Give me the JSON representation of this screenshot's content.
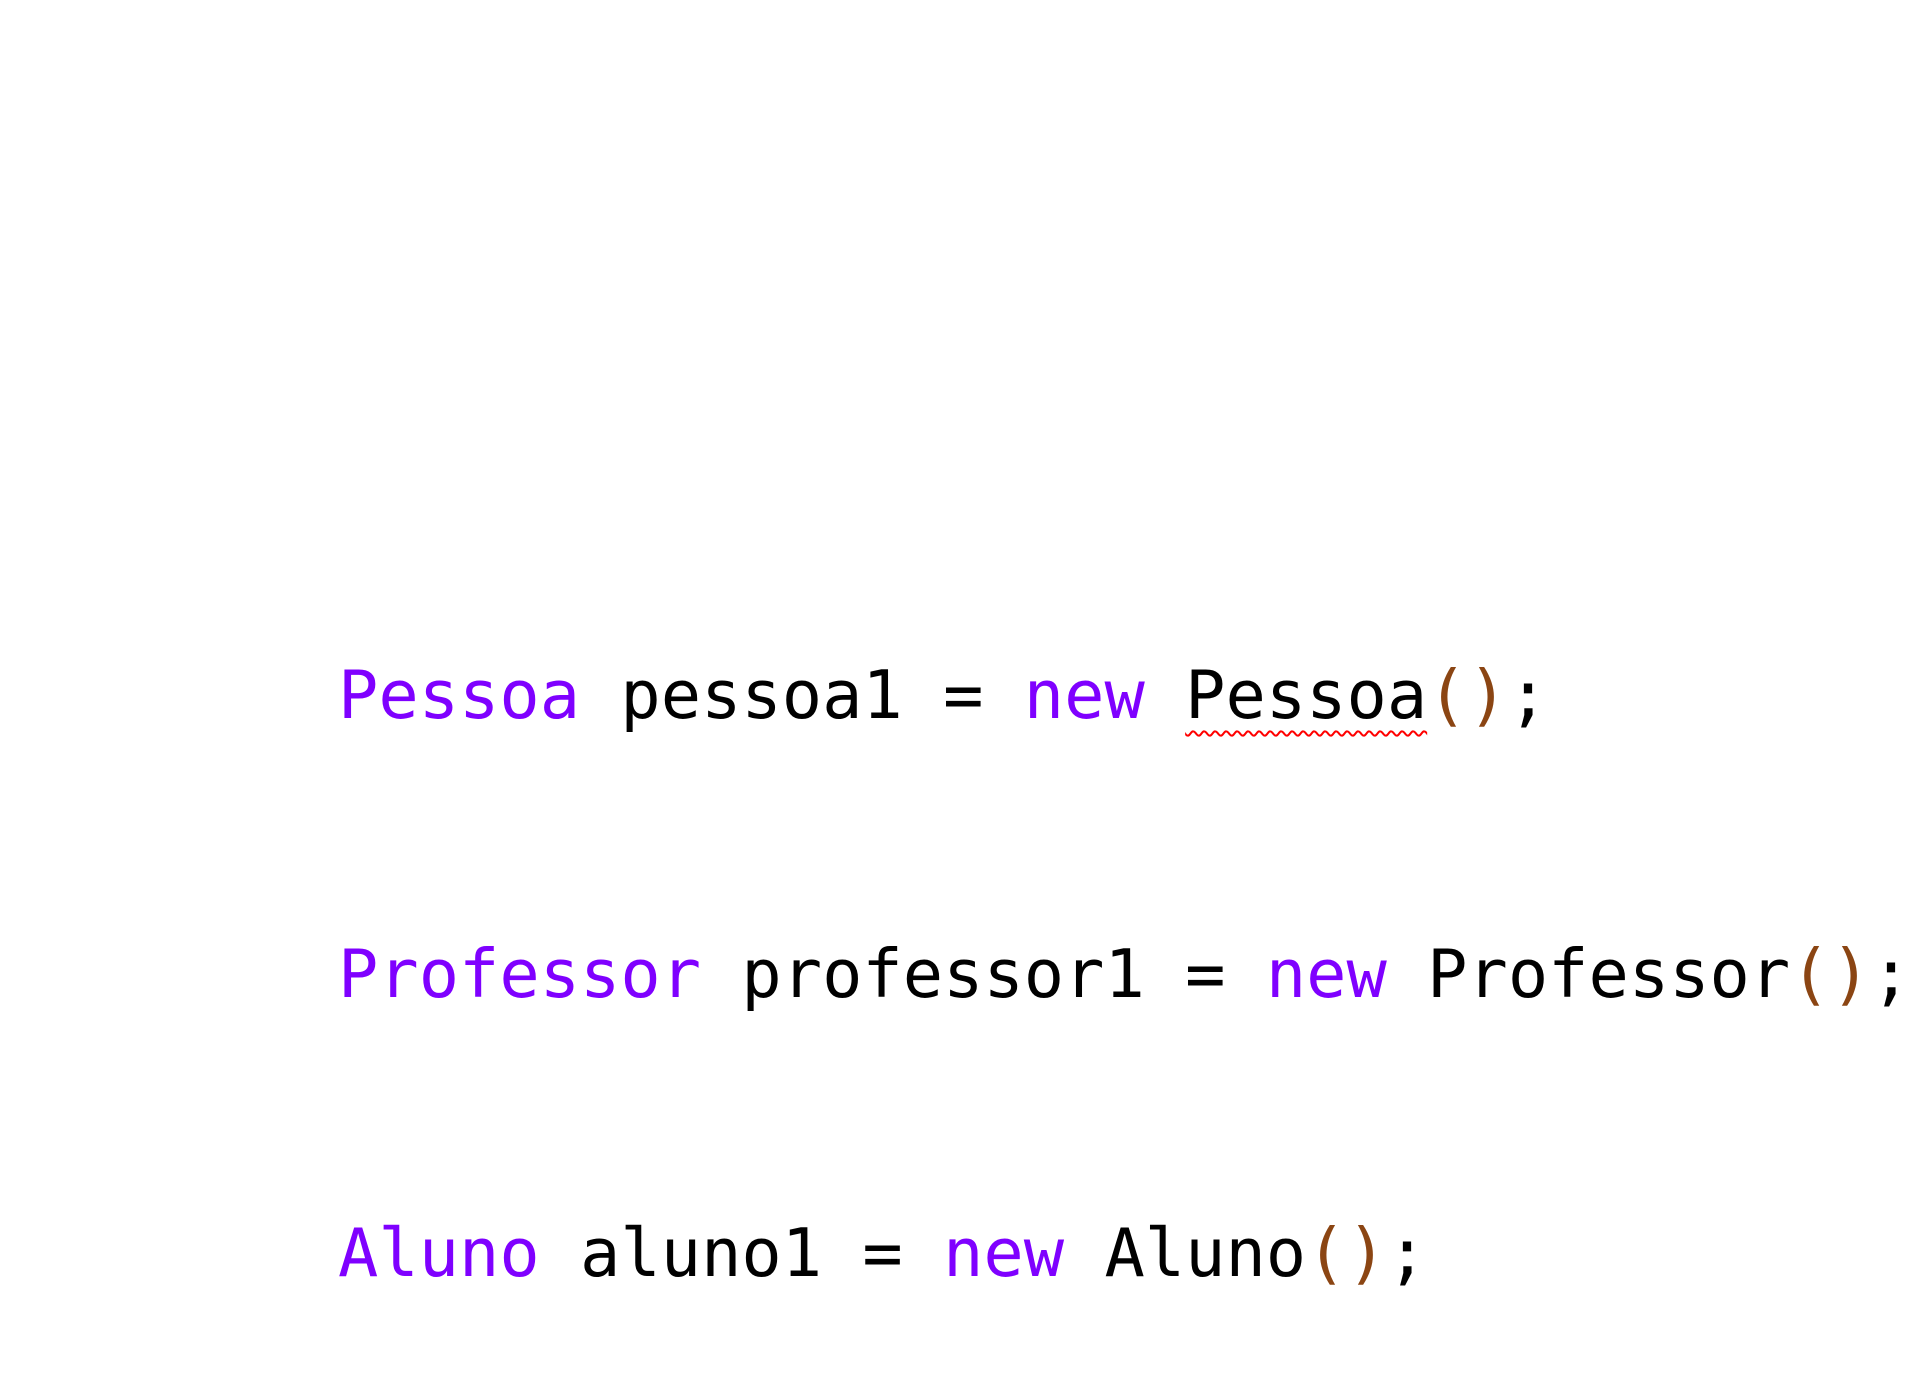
{
  "colors": {
    "type": "#7f00ff",
    "keyword": "#7f00ff",
    "identifier": "#000000",
    "paren": "#8b4513",
    "error_underline": "#ff0000"
  },
  "code": {
    "lines": [
      {
        "tokens": [
          {
            "text": "Pessoa",
            "kind": "type"
          },
          {
            "text": " pessoa1 = ",
            "kind": "identifier"
          },
          {
            "text": "new",
            "kind": "keyword"
          },
          {
            "text": " ",
            "kind": "identifier"
          },
          {
            "text": "Pessoa",
            "kind": "identifier",
            "error": true
          },
          {
            "text": "()",
            "kind": "paren"
          },
          {
            "text": ";",
            "kind": "identifier"
          }
        ]
      },
      {
        "tokens": [
          {
            "text": "Professor",
            "kind": "type"
          },
          {
            "text": " professor1 = ",
            "kind": "identifier"
          },
          {
            "text": "new",
            "kind": "keyword"
          },
          {
            "text": " Professor",
            "kind": "identifier"
          },
          {
            "text": "()",
            "kind": "paren"
          },
          {
            "text": ";",
            "kind": "identifier"
          }
        ]
      },
      {
        "tokens": [
          {
            "text": "Aluno",
            "kind": "type"
          },
          {
            "text": " aluno1 = ",
            "kind": "identifier"
          },
          {
            "text": "new",
            "kind": "keyword"
          },
          {
            "text": " Aluno",
            "kind": "identifier"
          },
          {
            "text": "()",
            "kind": "paren"
          },
          {
            "text": ";",
            "kind": "identifier"
          }
        ]
      }
    ]
  }
}
